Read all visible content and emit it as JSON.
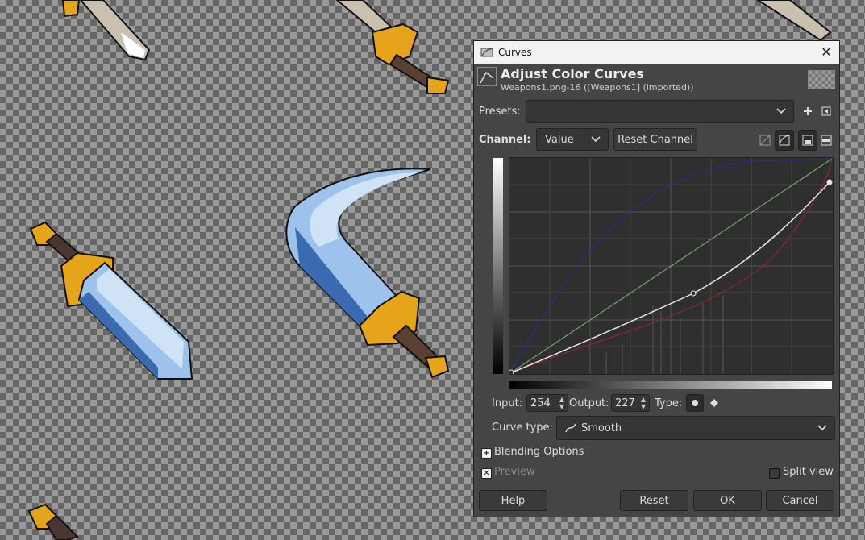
{
  "window": {
    "title": "Curves"
  },
  "header": {
    "title": "Adjust Color Curves",
    "subtitle": "Weapons1.png-16 ([Weapons1] (imported))"
  },
  "presets": {
    "label": "Presets:",
    "value": ""
  },
  "channel": {
    "label": "Channel:",
    "value": "Value",
    "reset_label": "Reset Channel"
  },
  "point": {
    "input_label": "Input:",
    "input_value": "254",
    "output_label": "Output:",
    "output_value": "227",
    "type_label": "Type:"
  },
  "curve_type": {
    "label": "Curve type:",
    "value": "Smooth"
  },
  "blending": {
    "label": "Blending Options"
  },
  "preview": {
    "label": "Preview",
    "checked": true
  },
  "split_view": {
    "label": "Split view",
    "checked": false
  },
  "buttons": {
    "help": "Help",
    "reset": "Reset",
    "ok": "OK",
    "cancel": "Cancel"
  },
  "icons": {
    "app": "curves-app-icon",
    "close": "close-icon",
    "add_preset": "plus-icon",
    "preset_menu": "preset-menu-icon",
    "linear_hist": "linear-histogram-icon",
    "log_hist": "log-histogram-icon",
    "smooth_point": "smooth-point-icon",
    "corner_point": "corner-point-icon"
  },
  "colors": {
    "dialog_bg": "#454545",
    "curve_value": "#e6e6e6",
    "curve_blue": "#2a2f8a",
    "curve_green": "#6aa86a",
    "curve_red": "#8a2a2a"
  }
}
